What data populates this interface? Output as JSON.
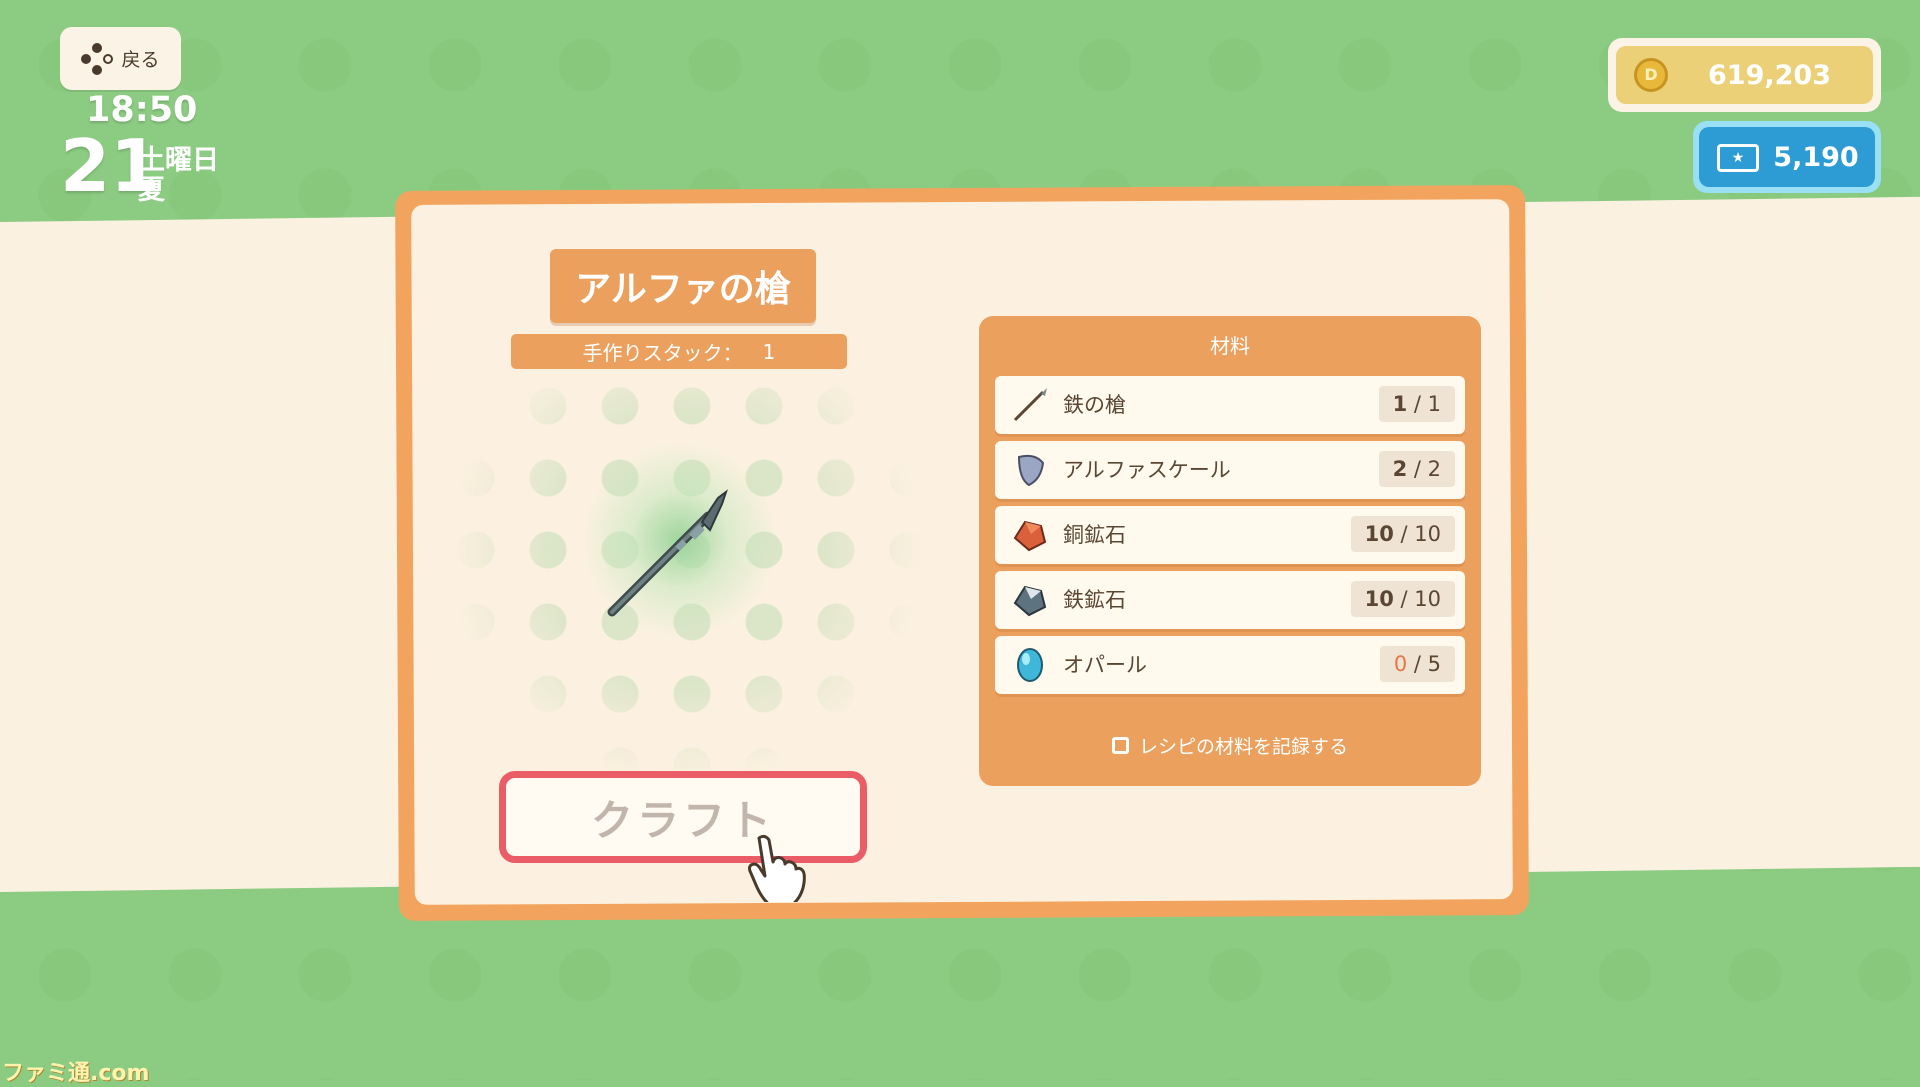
{
  "hud": {
    "back_label": "戻る",
    "time": "18:50",
    "day": "21",
    "weekday": "土曜日",
    "season": "夏"
  },
  "currency": {
    "gold": "619,203",
    "tickets": "5,190"
  },
  "craft": {
    "item_name": "アルファの槍",
    "stack_label": "手作りスタック：",
    "stack_value": "1",
    "button_label": "クラフト"
  },
  "materials": {
    "header": "材料",
    "items": [
      {
        "name": "鉄の槍",
        "have": "1",
        "need": "1",
        "icon": "iron-spear-icon"
      },
      {
        "name": "アルファスケール",
        "have": "2",
        "need": "2",
        "icon": "alpha-scale-icon"
      },
      {
        "name": "銅鉱石",
        "have": "10",
        "need": "10",
        "icon": "copper-ore-icon"
      },
      {
        "name": "鉄鉱石",
        "have": "10",
        "need": "10",
        "icon": "iron-ore-icon"
      },
      {
        "name": "オパール",
        "have": "0",
        "need": "5",
        "icon": "opal-icon"
      }
    ],
    "record_label": "レシピの材料を記録する"
  },
  "colors": {
    "accent_orange": "#eba05e",
    "craft_border": "#ea5d66",
    "lacking": "#e8754a",
    "ticket_blue": "#2d9cd5",
    "gold": "#ecd078"
  },
  "watermark": "ファミ通.com"
}
